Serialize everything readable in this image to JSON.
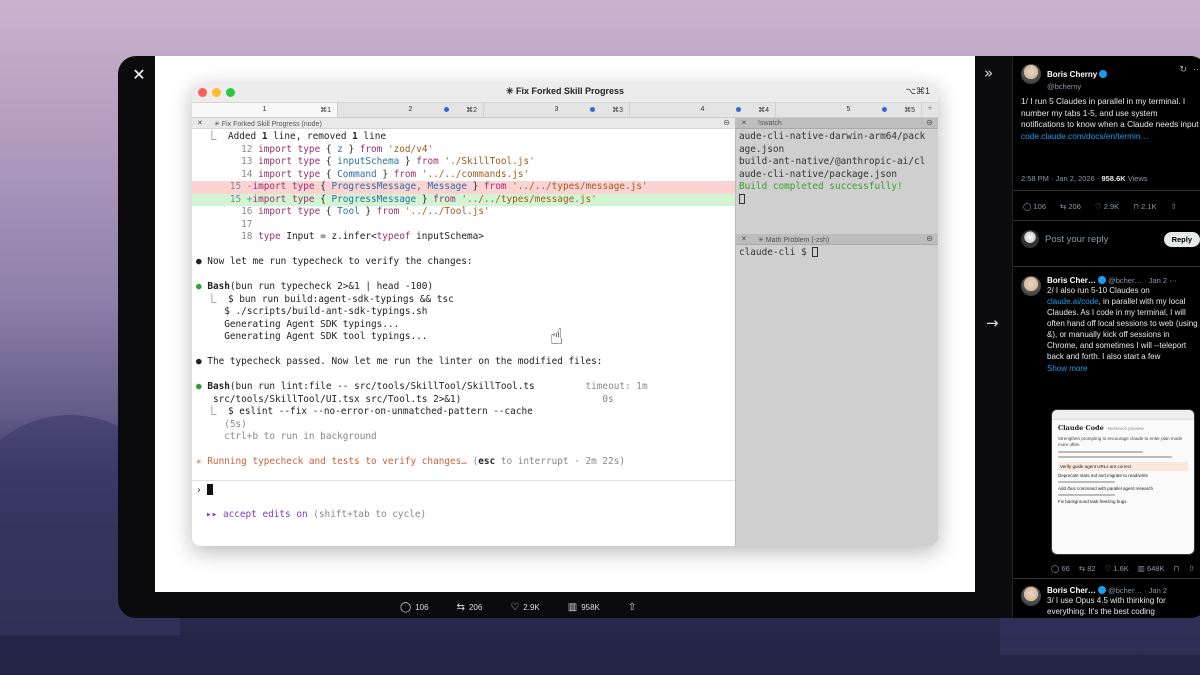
{
  "frame": {
    "close_label": "✕",
    "collapse_label": "»",
    "nav_arrow_label": "→"
  },
  "terminal": {
    "window_title": "✳ Fix Forked Skill Progress",
    "window_shortcut": "⌥⌘1",
    "tabs": [
      {
        "num": "1",
        "shortcut": "⌘1",
        "active": true,
        "dot": false
      },
      {
        "num": "2",
        "shortcut": "⌘2",
        "active": false,
        "dot": true
      },
      {
        "num": "3",
        "shortcut": "⌘3",
        "active": false,
        "dot": true
      },
      {
        "num": "4",
        "shortcut": "⌘4",
        "active": false,
        "dot": true
      },
      {
        "num": "5",
        "shortcut": "⌘5",
        "active": false,
        "dot": true
      }
    ],
    "tab_plus": "+",
    "left_pane": {
      "title": "✳ Fix Forked Skill Progress (node)",
      "diff_summary": {
        "prefix": "  ⎿  Added ",
        "added": "1",
        "mid": " line, removed ",
        "removed": "1",
        "suffix": " line"
      },
      "diff_lines": [
        {
          "num": "12",
          "text": "import type { z } from 'zod/v4'"
        },
        {
          "num": "13",
          "text": "import type { inputSchema } from './SkillTool.js'"
        },
        {
          "num": "14",
          "text": "import type { Command } from '../../commands.js'"
        },
        {
          "num": "15 -",
          "text": "import type { ProgressMessage, Message } from '../../types/message.js'",
          "kind": "del"
        },
        {
          "num": "15 +",
          "text": "import type { ProgressMessage } from '../../types/message.js'",
          "kind": "add"
        },
        {
          "num": "16",
          "text": "import type { Tool } from '../../Tool.js'"
        },
        {
          "num": "17",
          "text": ""
        },
        {
          "num": "18",
          "text": "type Input = z.infer<typeof inputSchema>"
        }
      ],
      "msg1": "Now let me run typecheck to verify the changes:",
      "bash1": {
        "tool": "Bash",
        "cmd": "(bun run typecheck 2>&1 | head -100)",
        "out": [
          "⎿  $ bun run build:agent-sdk-typings && tsc",
          "   $ ./scripts/build-ant-sdk-typings.sh",
          "   Generating Agent SDK typings...",
          "   Generating Agent SDK tool typings..."
        ]
      },
      "msg2": "The typecheck passed. Now let me run the linter on the modified files:",
      "bash2": {
        "tool": "Bash",
        "cmd": "(bun run lint:file -- src/tools/SkillTool/SkillTool.ts",
        "cmd2": " src/tools/SkillTool/UI.tsx src/Tool.ts 2>&1)",
        "timeout": "timeout: 1m",
        "timeout2": "0s",
        "out": [
          "⎿  $ eslint --fix --no-error-on-unmatched-pattern --cache",
          "   (5s)",
          "   ctrl+b to run in background"
        ]
      },
      "running": {
        "text": "✳ Running typecheck and tests to verify changes… ",
        "paren_open": "(",
        "key": "esc",
        "rest": " to interrupt · 2m 22s)"
      },
      "prompt": "›",
      "accept": {
        "arrows": "▸▸",
        "label": "accept edits on",
        "hint": " (shift+tab to cycle)"
      }
    },
    "right_pane": {
      "top_title": "!swatch",
      "top_lines": [
        "aude-cli-native-darwin-arm64/pack",
        "age.json",
        "build-ant-native/@anthropic-ai/cl",
        "aude-cli-native/package.json"
      ],
      "build_ok": "Build completed successfully!",
      "bottom_title": "✳ Math Problem (-zsh)",
      "shell_prompt": "claude-cli $ "
    }
  },
  "stats_bar": {
    "replies": "106",
    "reposts": "206",
    "likes": "2.9K",
    "views": "958K"
  },
  "sidebar": {
    "tweet1": {
      "name": "Boris Cherny",
      "handle": "@bcherny",
      "text_a": "1/ I run 5 Claudes in parallel in my terminal. I number my tabs 1-5, and use system notifications to know when a Claude needs input ",
      "link": "code.claude.com/docs/en/termin…",
      "time": "2:58 PM · Jan 2, 2026 · ",
      "views_count": "958.6K",
      "views_label": " Views",
      "replies": "106",
      "reposts": "206",
      "likes": "2.9K",
      "bookmarks": "2.1K"
    },
    "reply_box": {
      "placeholder": "Post your reply",
      "button": "Reply"
    },
    "tweet2": {
      "name": "Boris Cher…",
      "handle": "@bcher…",
      "date": "· Jan 2",
      "text_a": "2/ I also run 5-10 Claudes on ",
      "link": "claude.ai/code",
      "text_b": ", in parallel with my local Claudes. As I code in my terminal, I will often hand off local sessions to web (using &), or manually kick off sessions in Chrome, and sometimes I will --teleport back and forth. I also start a few",
      "show_more": "Show more",
      "replies": "66",
      "reposts": "82",
      "likes": "1.6K",
      "views": "648K"
    },
    "tweet3": {
      "name": "Boris Cher…",
      "handle": "@bcher…",
      "date": "· Jan 2",
      "text": "3/ I use Opus 4.5 with thinking for everything. It's the best coding"
    },
    "embed": {
      "brand": "Claude Code",
      "badge": "Research preview",
      "heading": "Strengthen prompting to encourage claude to enter plan mode more often",
      "items": [
        "Verify guide agent URLs are correct",
        "Deprecate stats.md and migrate to read/write",
        "Add /bus command with parallel agent research",
        "Fix background task freezing bugs"
      ]
    }
  }
}
